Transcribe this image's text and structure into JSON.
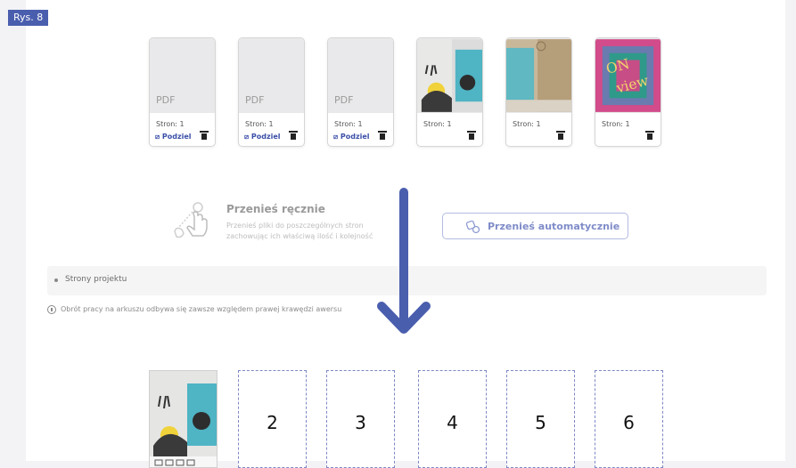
{
  "figure_label": "Rys. 8",
  "files": [
    {
      "type_label": "PDF",
      "pages_label": "Stron: 1",
      "split_label": "Podziel",
      "kind": "pdf"
    },
    {
      "type_label": "PDF",
      "pages_label": "Stron: 1",
      "split_label": "Podziel",
      "kind": "pdf"
    },
    {
      "type_label": "PDF",
      "pages_label": "Stron: 1",
      "split_label": "Podziel",
      "kind": "pdf"
    },
    {
      "pages_label": "Stron: 1",
      "kind": "image"
    },
    {
      "pages_label": "Stron: 1",
      "kind": "image"
    },
    {
      "pages_label": "Stron: 1",
      "kind": "image"
    }
  ],
  "manual": {
    "title": "Przenieś ręcznie",
    "desc_line1": "Przenieś pliki do poszczególnych stron",
    "desc_line2": "zachowując ich właściwą ilość i kolejność"
  },
  "auto_button": {
    "label": "Przenieś automatycznie"
  },
  "project_section": {
    "label": "Strony projektu"
  },
  "info": {
    "text": "Obrót pracy na arkuszu odbywa się zawsze względem prawej krawędzi awersu"
  },
  "pages": [
    "2",
    "3",
    "4",
    "5",
    "6"
  ],
  "colors": {
    "accent": "#3b4fa8",
    "arrow": "#4a5eae",
    "label_bg": "#4a5eae"
  }
}
